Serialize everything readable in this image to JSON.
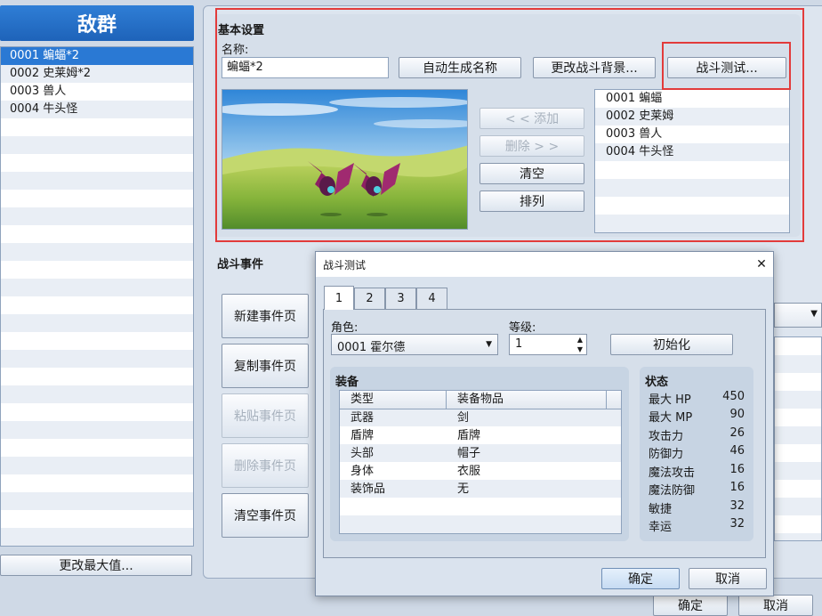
{
  "troops_panel": {
    "title": "敌群",
    "items": [
      {
        "label": "0001 蝙蝠*2"
      },
      {
        "label": "0002 史莱姆*2"
      },
      {
        "label": "0003 兽人"
      },
      {
        "label": "0004 牛头怪"
      }
    ],
    "selected_index": 0,
    "change_max_label": "更改最大值..."
  },
  "basic_settings": {
    "title": "基本设置",
    "name_label": "名称:",
    "name_value": "蝙蝠*2",
    "auto_name_label": "自动生成名称",
    "change_bg_label": "更改战斗背景...",
    "battle_test_label": "战斗测试...",
    "add_label": "< < 添加",
    "remove_label": "删除 > >",
    "clear_label": "清空",
    "arrange_label": "排列",
    "enemies": [
      {
        "label": "0001 蝙蝠"
      },
      {
        "label": "0002 史莱姆"
      },
      {
        "label": "0003 兽人"
      },
      {
        "label": "0004 牛头怪"
      }
    ]
  },
  "battle_events": {
    "title": "战斗事件",
    "new_page_label": "新建事件页",
    "copy_page_label": "复制事件页",
    "paste_page_label": "粘贴事件页",
    "delete_page_label": "删除事件页",
    "clear_page_label": "清空事件页"
  },
  "footer": {
    "ok_label": "确定",
    "cancel_label": "取消"
  },
  "dialog": {
    "title": "战斗测试",
    "close_glyph": "✕",
    "tabs": [
      {
        "label": "1"
      },
      {
        "label": "2"
      },
      {
        "label": "3"
      },
      {
        "label": "4"
      }
    ],
    "active_tab": 0,
    "actor_label": "角色:",
    "actor_value": "0001 霍尔德",
    "level_label": "等级:",
    "level_value": "1",
    "init_label": "初始化",
    "equipment": {
      "title": "装备",
      "col_type": "类型",
      "col_item": "装备物品",
      "rows": [
        {
          "type": "武器",
          "item": "剑"
        },
        {
          "type": "盾牌",
          "item": "盾牌"
        },
        {
          "type": "头部",
          "item": "帽子"
        },
        {
          "type": "身体",
          "item": "衣服"
        },
        {
          "type": "装饰品",
          "item": "无"
        }
      ]
    },
    "status": {
      "title": "状态",
      "rows": [
        {
          "label": "最大 HP",
          "value": "450"
        },
        {
          "label": "最大 MP",
          "value": "90"
        },
        {
          "label": "攻击力",
          "value": "26"
        },
        {
          "label": "防御力",
          "value": "46"
        },
        {
          "label": "魔法攻击",
          "value": "16"
        },
        {
          "label": "魔法防御",
          "value": "16"
        },
        {
          "label": "敏捷",
          "value": "32"
        },
        {
          "label": "幸运",
          "value": "32"
        }
      ]
    },
    "ok_label": "确定",
    "cancel_label": "取消"
  },
  "colors": {
    "highlight": "#e23b3b",
    "selection": "#2a79d4"
  }
}
